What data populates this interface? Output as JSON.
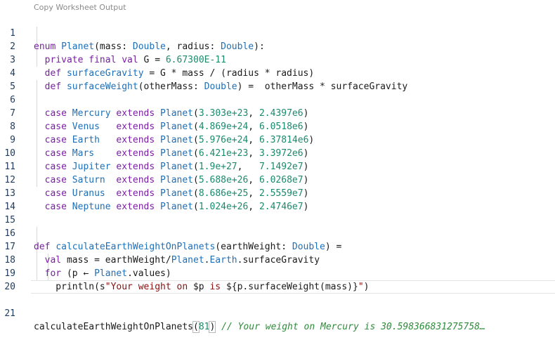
{
  "toolbar": {
    "copy_worksheet_output": "Copy Worksheet Output"
  },
  "editor": {
    "line_numbers": [
      "1",
      "2",
      "3",
      "4",
      "5",
      "6",
      "7",
      "8",
      "9",
      "10",
      "11",
      "12",
      "13",
      "14",
      "15",
      "16",
      "17",
      "18",
      "19",
      "20",
      "21"
    ],
    "l1": {
      "a": "enum",
      "b": " ",
      "c": "Planet",
      "d": "(mass: ",
      "e": "Double",
      "f": ", radius: ",
      "g": "Double",
      "h": "):"
    },
    "l2": {
      "a": "  private final val",
      "b": " G = ",
      "c": "6.67300E-11"
    },
    "l3": {
      "a": "  def",
      "b": " ",
      "c": "surfaceGravity",
      "d": " = G * mass / (radius * radius)"
    },
    "l4": {
      "a": "  def",
      "b": " ",
      "c": "surfaceWeight",
      "d": "(otherMass: ",
      "e": "Double",
      "f": ") =  otherMass * surfaceGravity"
    },
    "cases": [
      {
        "kw": "  case",
        "name": " Mercury",
        "ext": " extends",
        "pl": " Planet",
        "p1": "(",
        "v1": "3.303e+23",
        "sep": ", ",
        "v2": "2.4397e6",
        "p2": ")"
      },
      {
        "kw": "  case",
        "name": " Venus  ",
        "ext": " extends",
        "pl": " Planet",
        "p1": "(",
        "v1": "4.869e+24",
        "sep": ", ",
        "v2": "6.0518e6",
        "p2": ")"
      },
      {
        "kw": "  case",
        "name": " Earth  ",
        "ext": " extends",
        "pl": " Planet",
        "p1": "(",
        "v1": "5.976e+24",
        "sep": ", ",
        "v2": "6.37814e6",
        "p2": ")"
      },
      {
        "kw": "  case",
        "name": " Mars   ",
        "ext": " extends",
        "pl": " Planet",
        "p1": "(",
        "v1": "6.421e+23",
        "sep": ", ",
        "v2": "3.3972e6",
        "p2": ")"
      },
      {
        "kw": "  case",
        "name": " Jupiter",
        "ext": " extends",
        "pl": " Planet",
        "p1": "(",
        "v1": "1.9e+27",
        "sep": ",   ",
        "v2": "7.1492e7",
        "p2": ")"
      },
      {
        "kw": "  case",
        "name": " Saturn ",
        "ext": " extends",
        "pl": " Planet",
        "p1": "(",
        "v1": "5.688e+26",
        "sep": ", ",
        "v2": "6.0268e7",
        "p2": ")"
      },
      {
        "kw": "  case",
        "name": " Uranus ",
        "ext": " extends",
        "pl": " Planet",
        "p1": "(",
        "v1": "8.686e+25",
        "sep": ", ",
        "v2": "2.5559e7",
        "p2": ")"
      },
      {
        "kw": "  case",
        "name": " Neptune",
        "ext": " extends",
        "pl": " Planet",
        "p1": "(",
        "v1": "1.024e+26",
        "sep": ", ",
        "v2": "2.4746e7",
        "p2": ")"
      }
    ],
    "l16": {
      "a": "def",
      "b": " ",
      "c": "calculateEarthWeightOnPlanets",
      "d": "(earthWeight: ",
      "e": "Double",
      "f": ") ="
    },
    "l17": {
      "a": "  val",
      "b": " mass = earthWeight/",
      "c": "Planet",
      "d": ".",
      "e": "Earth",
      "f": ".surfaceGravity"
    },
    "l18": {
      "a": "  for",
      "b": " (p ← ",
      "c": "Planet",
      "d": ".values)"
    },
    "l19": {
      "a": "    println(s",
      "b": "\"Your weight on ",
      "c": "$p",
      "d": " is ",
      "e": "${",
      "f": "p.surfaceWeight(mass)",
      "g": "}",
      "h": "\"",
      "i": ")"
    },
    "l21": {
      "a": "calculateEarthWeightOnPlanets",
      "b": "(",
      "c": "81",
      "d": ")",
      "e": " // Your weight on Mercury is 30.598366831275758…"
    }
  }
}
